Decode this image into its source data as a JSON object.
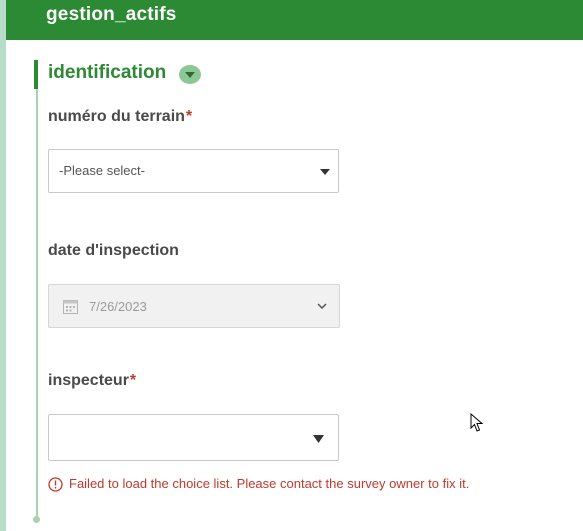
{
  "header": {
    "title": "gestion_actifs"
  },
  "group": {
    "title": "identification",
    "collapse_icon": "chevron-down-icon"
  },
  "questions": [
    {
      "label": "numéro du terrain",
      "required_mark": "*",
      "control": "select",
      "value": "-Please select-"
    },
    {
      "label": "date d'inspection",
      "control": "date",
      "value": "7/26/2023",
      "disabled": true
    },
    {
      "label": "inspecteur",
      "required_mark": "*",
      "control": "select",
      "value": ""
    }
  ],
  "error": {
    "message": "Failed to load the choice list. Please contact the survey owner to fix it."
  },
  "colors": {
    "header_bg": "#2d8a34",
    "accent": "#2d8a34",
    "error": "#c0392b",
    "group_line": "#a9d3ae"
  }
}
